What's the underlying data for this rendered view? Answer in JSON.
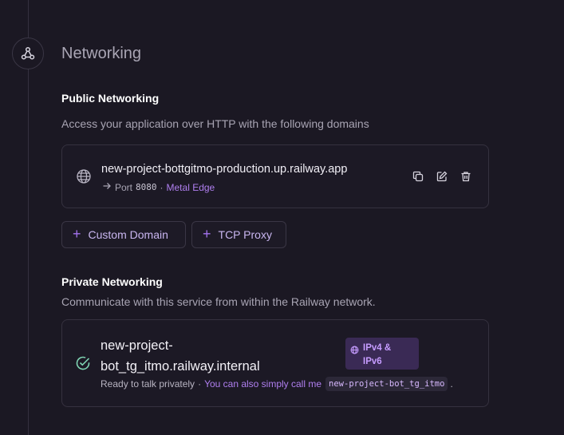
{
  "section": {
    "title": "Networking",
    "icon": "network-nodes-icon"
  },
  "public": {
    "heading": "Public Networking",
    "description": "Access your application over HTTP with the following domains",
    "domain": {
      "name": "new-project-bottgitmo-production.up.railway.app",
      "port_label": "Port",
      "port": "8080",
      "separator": "·",
      "edge": "Metal Edge",
      "actions": [
        "copy-icon",
        "edit-icon",
        "trash-icon"
      ]
    },
    "buttons": {
      "custom_domain": "Custom Domain",
      "tcp_proxy": "TCP Proxy"
    }
  },
  "private": {
    "heading": "Private Networking",
    "description": "Communicate with this service from within the Railway network.",
    "name_line1": "new-project-",
    "name_line2": "bot_tg_itmo.railway.internal",
    "badge_line1": "IPv4 &",
    "badge_line2": "IPv6",
    "status": "Ready to talk privately",
    "separator": "·",
    "alias_text": "You can also simply call me",
    "alias": "new-project-bot_tg_itmo",
    "period": "."
  },
  "colors": {
    "background": "#1b1823",
    "accent": "#b07ff0",
    "success": "#7fd4b3",
    "badge_bg": "#3a2a55"
  }
}
